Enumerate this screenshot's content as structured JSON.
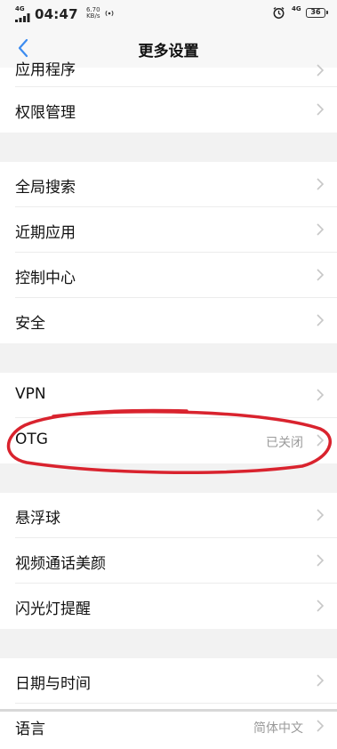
{
  "status_bar": {
    "network": "4G",
    "time": "04:47",
    "speed_value": "6.70",
    "speed_unit": "KB/s",
    "network_right": "4G",
    "battery": "36"
  },
  "header": {
    "title": "更多设置"
  },
  "groups": [
    {
      "items": [
        {
          "label": "应用程序",
          "value": ""
        },
        {
          "label": "权限管理",
          "value": ""
        }
      ]
    },
    {
      "items": [
        {
          "label": "全局搜索",
          "value": ""
        },
        {
          "label": "近期应用",
          "value": ""
        },
        {
          "label": "控制中心",
          "value": ""
        },
        {
          "label": "安全",
          "value": ""
        }
      ]
    },
    {
      "items": [
        {
          "label": "VPN",
          "value": ""
        },
        {
          "label": "OTG",
          "value": "已关闭"
        }
      ]
    },
    {
      "items": [
        {
          "label": "悬浮球",
          "value": ""
        },
        {
          "label": "视频通话美颜",
          "value": ""
        },
        {
          "label": "闪光灯提醒",
          "value": ""
        }
      ]
    },
    {
      "items": [
        {
          "label": "日期与时间",
          "value": ""
        },
        {
          "label": "语言",
          "value": "简体中文"
        }
      ]
    }
  ],
  "annotation_color": "#d9232e"
}
